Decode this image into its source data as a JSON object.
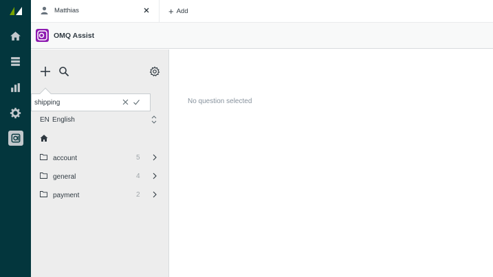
{
  "tabs": [
    {
      "label": "Matthias",
      "icon": "user-icon"
    }
  ],
  "add_tab": {
    "label": "Add"
  },
  "app": {
    "title": "OMQ Assist",
    "brand_color": "#8e1bb1"
  },
  "rail": {
    "items": [
      "home-icon",
      "views-icon",
      "reporting-icon",
      "admin-icon",
      "omq-app-icon"
    ],
    "active": "omq-app-icon"
  },
  "search": {
    "value": "shipping",
    "placeholder": ""
  },
  "language": {
    "code": "EN",
    "name": "English"
  },
  "folders": [
    {
      "name": "account",
      "count": "5"
    },
    {
      "name": "general",
      "count": "4"
    },
    {
      "name": "payment",
      "count": "2"
    }
  ],
  "empty_state": {
    "text": "No question selected"
  }
}
